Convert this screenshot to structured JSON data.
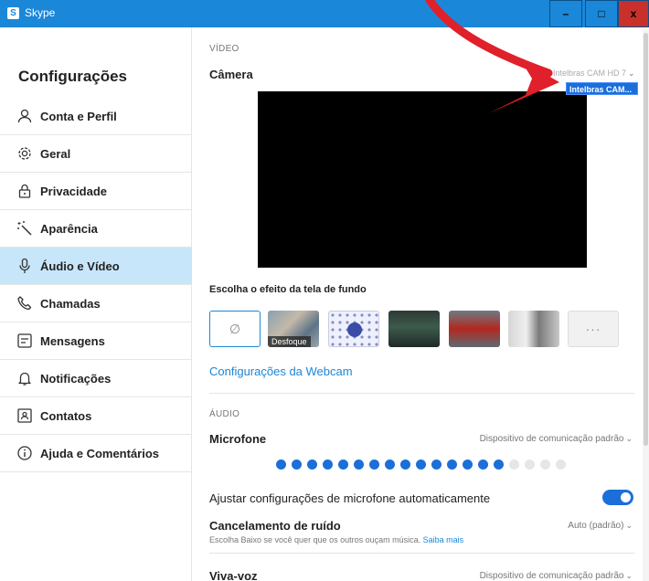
{
  "window": {
    "title": "Skype",
    "logo_letter": "S",
    "min_glyph": "–",
    "max_glyph": "□",
    "close_glyph": "x"
  },
  "sidebar": {
    "title": "Configurações",
    "items": [
      {
        "label": "Conta e Perfil",
        "icon": "person-icon",
        "active": false
      },
      {
        "label": "Geral",
        "icon": "gear-icon",
        "active": false
      },
      {
        "label": "Privacidade",
        "icon": "lock-icon",
        "active": false
      },
      {
        "label": "Aparência",
        "icon": "magic-wand-icon",
        "active": false
      },
      {
        "label": "Áudio e Vídeo",
        "icon": "microphone-icon",
        "active": true
      },
      {
        "label": "Chamadas",
        "icon": "phone-icon",
        "active": false
      },
      {
        "label": "Mensagens",
        "icon": "message-icon",
        "active": false
      },
      {
        "label": "Notificações",
        "icon": "bell-icon",
        "active": false
      },
      {
        "label": "Contatos",
        "icon": "contact-card-icon",
        "active": false
      },
      {
        "label": "Ajuda e Comentários",
        "icon": "info-icon",
        "active": false
      }
    ]
  },
  "video": {
    "section_label": "VÍDEO",
    "camera_label": "Câmera",
    "camera_value": "Intelbras CAM HD 7",
    "camera_dropdown_option": "Intelbras CAM...",
    "background_title": "Escolha o efeito da tela de fundo",
    "background_none_glyph": "∅",
    "blur_caption": "Desfoque",
    "more_glyph": "···",
    "webcam_link": "Configurações da Webcam"
  },
  "audio": {
    "section_label": "ÁUDIO",
    "microphone_label": "Microfone",
    "microphone_value": "Dispositivo de comunicação padrão",
    "mic_level_active_dots": 15,
    "mic_level_total_dots": 19,
    "auto_adjust_label": "Ajustar configurações de microfone automaticamente",
    "auto_adjust_on": true,
    "noise_label": "Cancelamento de ruído",
    "noise_value": "Auto (padrão)",
    "noise_help": "Escolha Baixo se você quer que os outros ouçam música.",
    "noise_help_link": "Saiba mais",
    "speaker_label": "Viva-voz",
    "speaker_value": "Dispositivo de comunicação padrão"
  },
  "colors": {
    "accent": "#1b87d8",
    "active_nav": "#c8e6f9",
    "annotation_arrow": "#e0202a",
    "meter_active": "#1b6fd8",
    "meter_inactive": "#e6e6e6"
  }
}
